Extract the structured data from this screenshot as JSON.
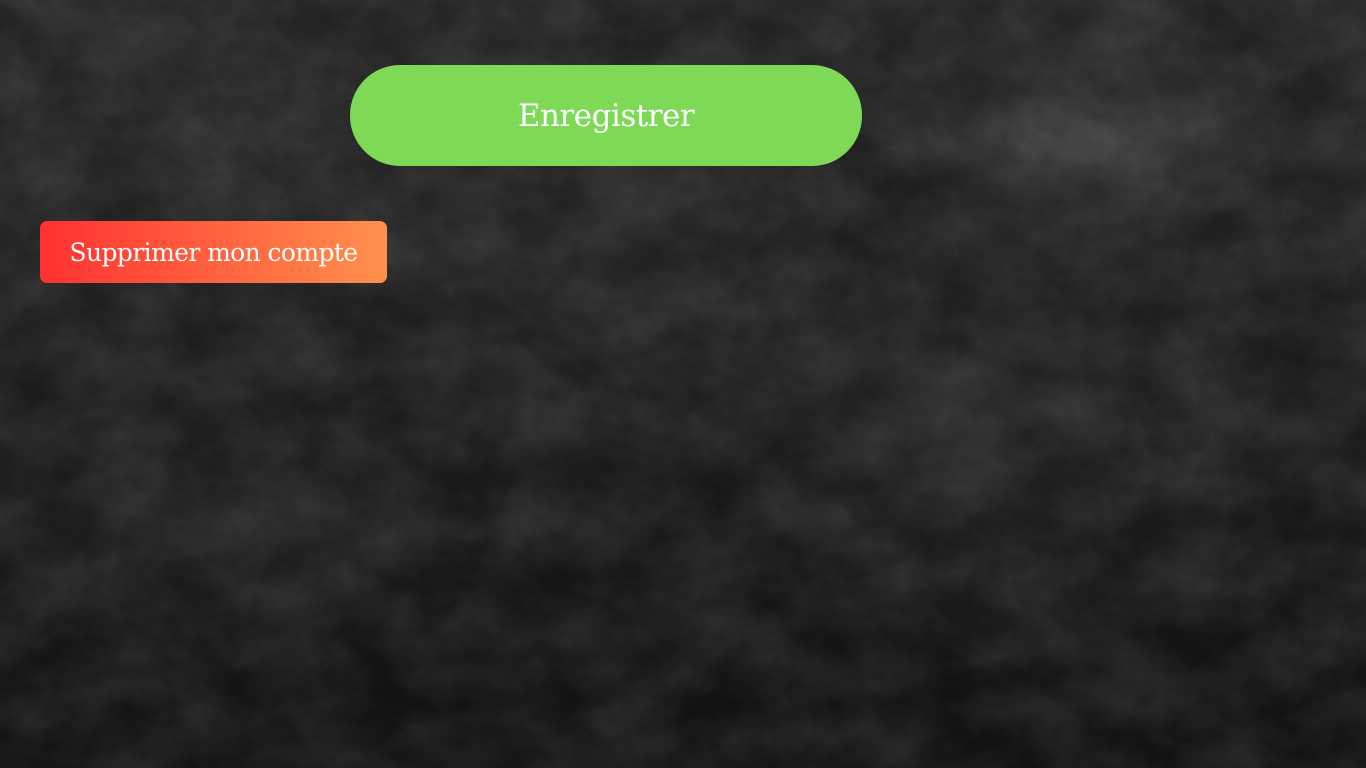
{
  "buttons": {
    "save_label": "Enregistrer",
    "delete_account_label": "Supprimer mon compte"
  },
  "colors": {
    "save_button": "#7ed957",
    "delete_button_start": "#ff3131",
    "delete_button_end": "#ff914d",
    "background": "#1c1c1c",
    "text": "#ffffff"
  }
}
